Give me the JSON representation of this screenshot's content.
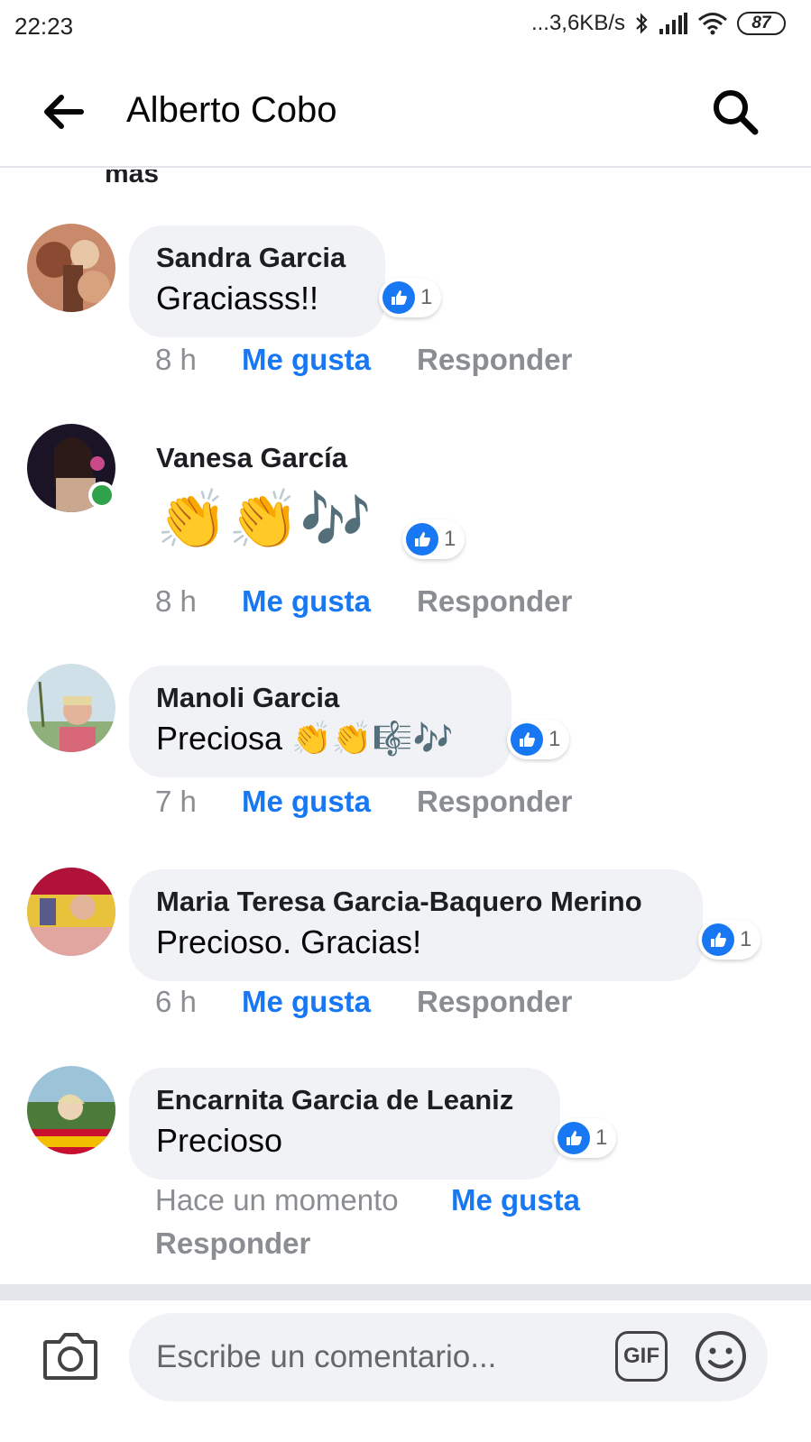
{
  "status_bar": {
    "time": "22:23",
    "network_speed": "...3,6KB/s",
    "battery": "87"
  },
  "header": {
    "title": "Alberto Cobo"
  },
  "cut_off_text": "mas",
  "comments": [
    {
      "author": "Sandra Garcia",
      "text": "Graciasss!!",
      "reaction_count": "1",
      "time": "8 h",
      "like_label": "Me gusta",
      "reply_label": "Responder"
    },
    {
      "author": "Vanesa García",
      "text": "👏👏🎶",
      "reaction_count": "1",
      "time": "8 h",
      "like_label": "Me gusta",
      "reply_label": "Responder",
      "online": true
    },
    {
      "author": "Manoli Garcia",
      "text": "Preciosa 👏👏🎼🎶",
      "reaction_count": "1",
      "time": "7 h",
      "like_label": "Me gusta",
      "reply_label": "Responder"
    },
    {
      "author": "Maria Teresa Garcia-Baquero Merino",
      "text": "Precioso. Gracias!",
      "reaction_count": "1",
      "time": "6 h",
      "like_label": "Me gusta",
      "reply_label": "Responder"
    },
    {
      "author": "Encarnita Garcia de Leaniz",
      "text": "Precioso",
      "reaction_count": "1",
      "time": "Hace un momento",
      "like_label": "Me gusta",
      "reply_label": "Responder"
    }
  ],
  "footer": {
    "input_placeholder": "Escribe un comentario...",
    "gif_label": "GIF"
  },
  "colors": {
    "accent": "#1877f2",
    "bubble": "#f0f2f5",
    "muted": "#8a8d91",
    "online": "#31a24c"
  }
}
